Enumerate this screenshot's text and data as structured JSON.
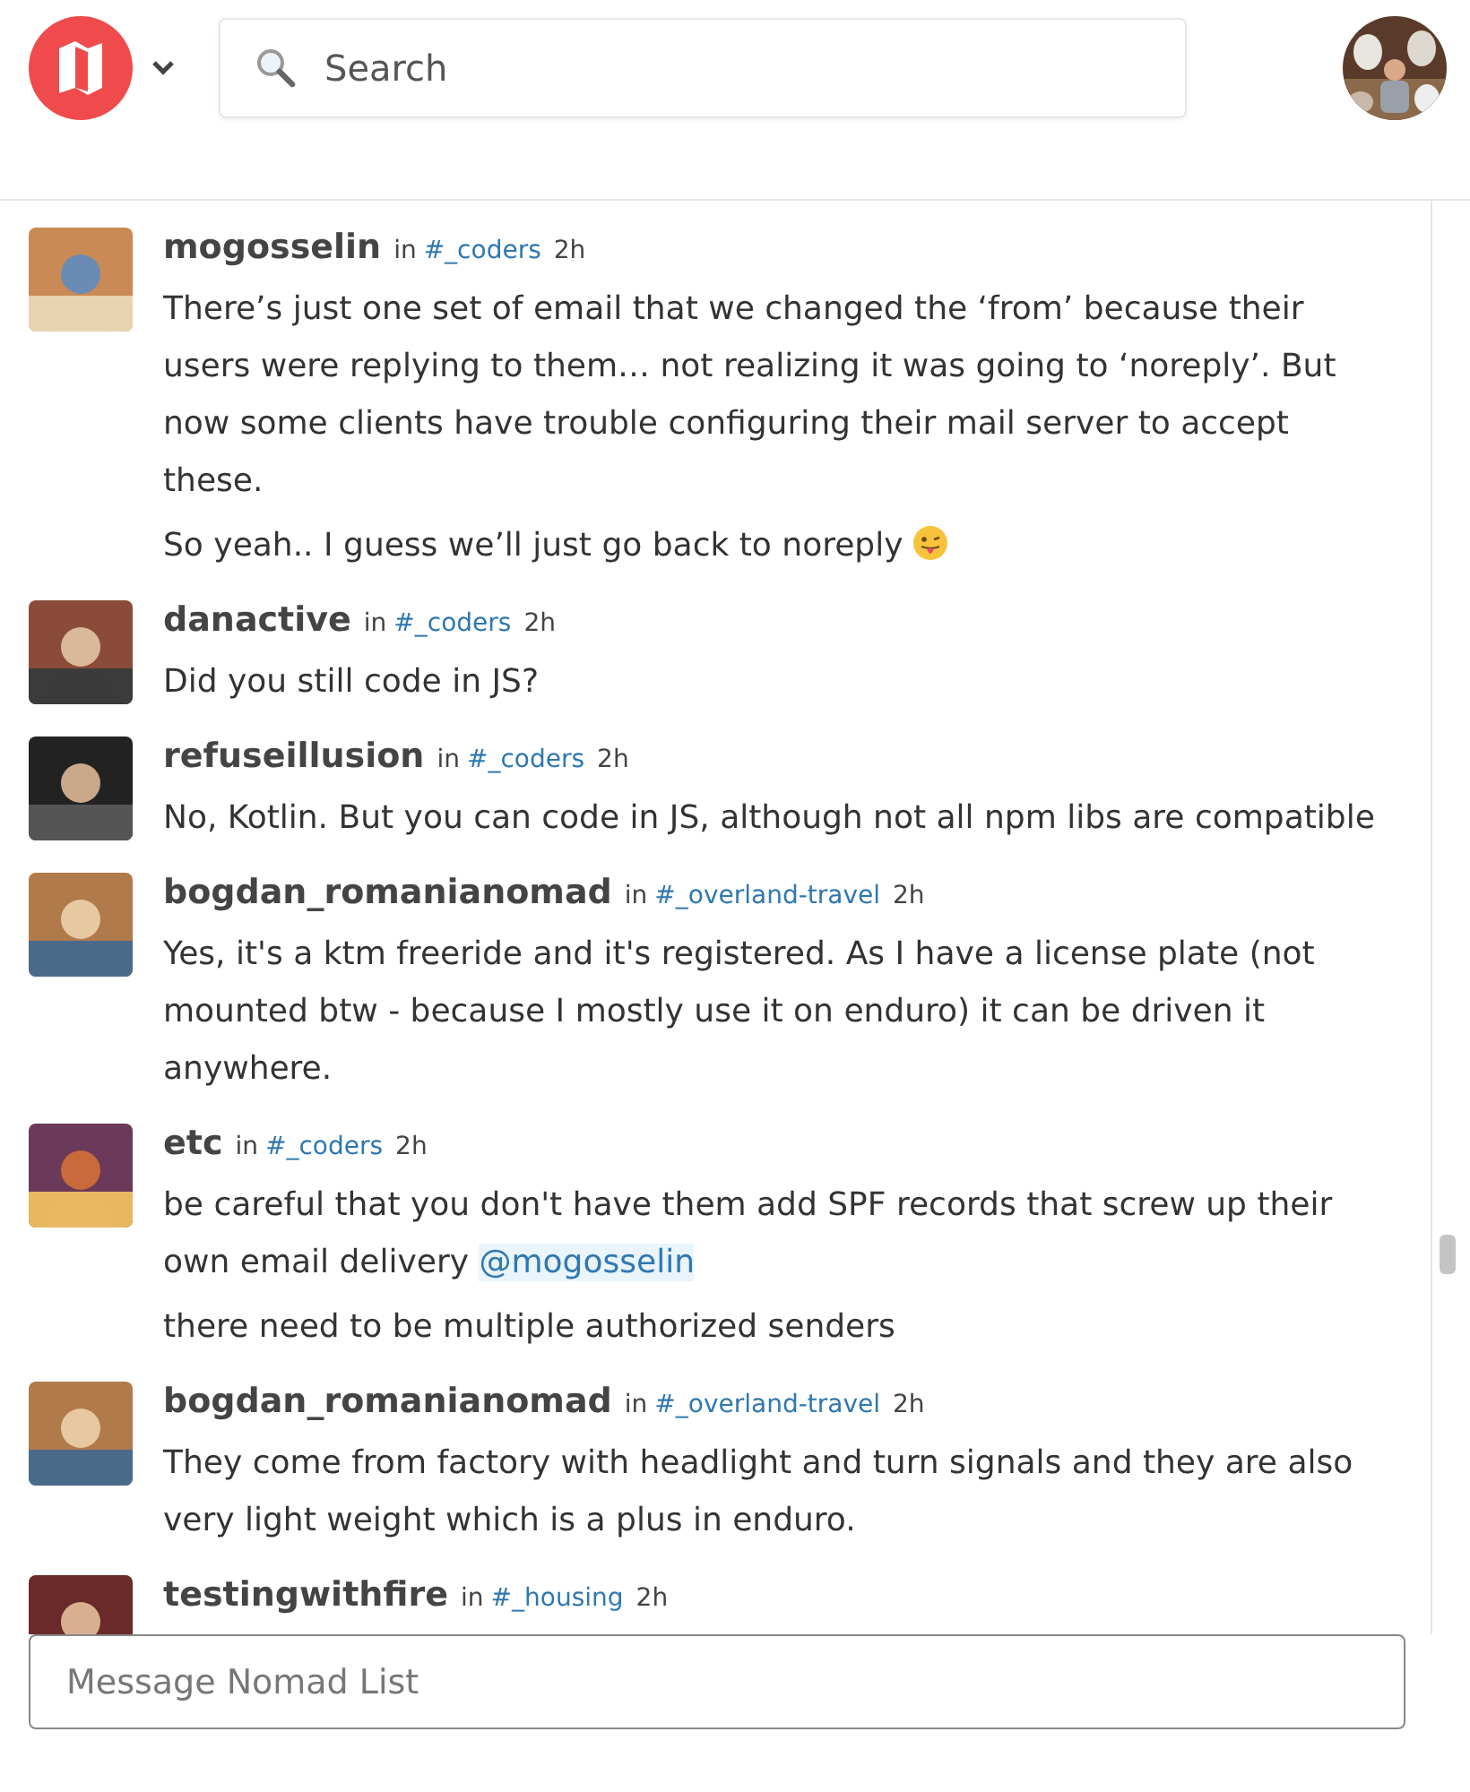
{
  "header": {
    "search": {
      "placeholder": "Search"
    }
  },
  "messages": [
    {
      "user": "mogosselin",
      "in": "in",
      "channel": "#_coders",
      "time": "2h",
      "paragraphs": [
        {
          "text": "There’s just one set of email that we changed the ‘from’ because their users were replying to them… not realizing it was going to ‘noreply’. But now some clients have trouble configuring their mail server to accept these."
        },
        {
          "text": "So yeah.. I guess we’ll just go back to noreply",
          "emoji": true
        }
      ]
    },
    {
      "user": "danactive",
      "in": "in",
      "channel": "#_coders",
      "time": "2h",
      "paragraphs": [
        {
          "text": "Did you still code in JS?"
        }
      ]
    },
    {
      "user": "refuseillusion",
      "in": "in",
      "channel": "#_coders",
      "time": "2h",
      "paragraphs": [
        {
          "text": "No, Kotlin. But you can code in JS, although not all npm libs are compatible"
        }
      ]
    },
    {
      "user": "bogdan_romanianomad",
      "in": "in",
      "channel": "#_overland-travel",
      "time": "2h",
      "paragraphs": [
        {
          "text": "Yes, it's a ktm freeride and it's registered. As I have a license plate (not mounted btw - because I mostly use it on enduro) it can be driven it anywhere."
        }
      ]
    },
    {
      "user": "etc",
      "in": "in",
      "channel": "#_coders",
      "time": "2h",
      "paragraphs": [
        {
          "text": "be careful that you don't have them add SPF records that screw up their own email delivery",
          "mention": "@mogosselin"
        },
        {
          "text": "there need to be multiple authorized senders"
        }
      ]
    },
    {
      "user": "bogdan_romanianomad",
      "in": "in",
      "channel": "#_overland-travel",
      "time": "2h",
      "paragraphs": [
        {
          "text": "They come from factory with headlight and turn signals and they are also very light weight which is a plus in enduro."
        }
      ]
    },
    {
      "user": "testingwithfire",
      "in": "in",
      "channel": "#_housing",
      "time": "2h"
    }
  ],
  "composer": {
    "placeholder": "Message Nomad List"
  }
}
